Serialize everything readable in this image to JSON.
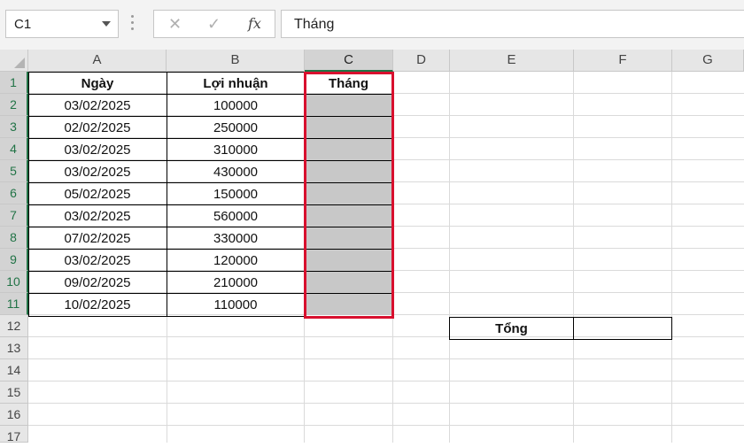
{
  "name_box": {
    "value": "C1"
  },
  "formula_bar": {
    "cancel_glyph": "✕",
    "enter_glyph": "✓",
    "fx_label": "fx",
    "content": "Tháng"
  },
  "columns": [
    "A",
    "B",
    "C",
    "D",
    "E",
    "F",
    "G"
  ],
  "rows": [
    "1",
    "2",
    "3",
    "4",
    "5",
    "6",
    "7",
    "8",
    "9",
    "10",
    "11",
    "12",
    "13",
    "14",
    "15",
    "16",
    "17"
  ],
  "table": {
    "headers": [
      "Ngày",
      "Lợi nhuận",
      "Tháng"
    ],
    "data": [
      [
        "03/02/2025",
        "100000",
        ""
      ],
      [
        "02/02/2025",
        "250000",
        ""
      ],
      [
        "03/02/2025",
        "310000",
        ""
      ],
      [
        "03/02/2025",
        "430000",
        ""
      ],
      [
        "05/02/2025",
        "150000",
        ""
      ],
      [
        "03/02/2025",
        "560000",
        ""
      ],
      [
        "07/02/2025",
        "330000",
        ""
      ],
      [
        "03/02/2025",
        "120000",
        ""
      ],
      [
        "09/02/2025",
        "210000",
        ""
      ],
      [
        "10/02/2025",
        "110000",
        ""
      ]
    ]
  },
  "summary": {
    "label": "Tổng",
    "value": ""
  },
  "selected": {
    "column": "C",
    "row": "1"
  },
  "colors": {
    "selection_border": "#d8102e",
    "excel_green": "#217346",
    "shaded_fill": "#c8c8c8"
  }
}
